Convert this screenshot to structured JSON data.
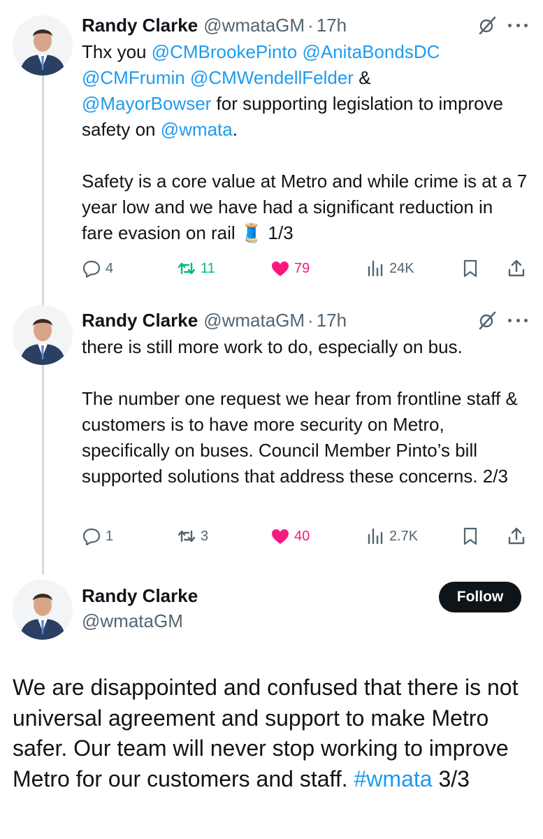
{
  "colors": {
    "accent": "#1d9bf0",
    "like": "#f91880",
    "retweet_active": "#00ba7c",
    "muted": "#536471",
    "text": "#0f1419",
    "thread_line": "#cfd9de"
  },
  "tweets": [
    {
      "name": "Randy Clarke",
      "handle": "@wmataGM",
      "separator": "·",
      "time": "17h",
      "body": {
        "p1_part1": "Thx you ",
        "m1": "@CMBrookePinto",
        "m2": "@AnitaBondsDC",
        "m3": "@CMFrumin",
        "m4": "@CMWendellFelder",
        "amp": " & ",
        "m5": "@MayorBowser",
        "p1_part2": " for supporting legislation to improve safety on ",
        "m6": "@wmata",
        "p1_end": ".",
        "p2": "Safety is a core value at Metro and while crime is at a 7 year low and we have had a significant reduction in fare evasion on rail ",
        "emoji": "🧵",
        "p2_end": " 1/3"
      },
      "actions": {
        "replies": "4",
        "reposts": "11",
        "likes": "79",
        "views": "24K"
      }
    },
    {
      "name": "Randy Clarke",
      "handle": "@wmataGM",
      "separator": "·",
      "time": "17h",
      "body": {
        "p1": "there is still more work to do, especially on bus.",
        "p2": "The number one request we hear from frontline staff & customers is to have more security on Metro, specifically on buses. Council Member Pinto’s bill supported solutions that address these concerns. 2/3"
      },
      "actions": {
        "replies": "1",
        "reposts": "3",
        "likes": "40",
        "views": "2.7K"
      }
    }
  ],
  "main_tweet": {
    "name": "Randy Clarke",
    "handle": "@wmataGM",
    "follow_label": "Follow",
    "body_text": "We are disappointed and confused that there is not universal agreement and support to make Metro safer. Our team will never stop working to improve Metro for our customers and staff. ",
    "hashtag": "#wmata",
    "body_end": " 3/3"
  },
  "icons": [
    "grok-icon",
    "more-icon",
    "reply-icon",
    "repost-icon",
    "like-icon",
    "views-icon",
    "bookmark-icon",
    "share-icon"
  ]
}
